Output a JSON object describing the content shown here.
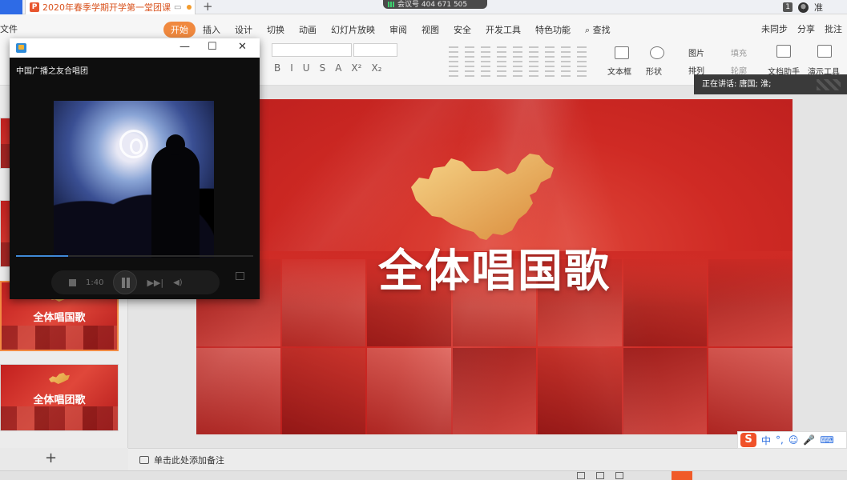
{
  "window": {
    "doc_tab_title": "2020年春季学期开学第一堂团课",
    "new_tab_symbol": "+",
    "meeting_label": "会议号 404 671 505",
    "page_badge": "1",
    "user_name": "准"
  },
  "menu": {
    "file_label": "文件",
    "tabs": [
      "开始",
      "插入",
      "设计",
      "切换",
      "动画",
      "幻灯片放映",
      "审阅",
      "视图",
      "安全",
      "开发工具",
      "特色功能"
    ],
    "active_tab": "开始",
    "search_label": "查找",
    "sync_label": "未同步",
    "share_label": "分享",
    "comment_label": "批注"
  },
  "ribbon": {
    "format_buttons": [
      "B",
      "I",
      "U",
      "S",
      "A",
      "X²",
      "X₂"
    ],
    "textbox_label": "文本框",
    "shape_label": "形状",
    "picture_label": "图片",
    "fill_label": "填充",
    "arrange_label": "排列",
    "outline_label": "轮廓",
    "assistant_label": "文档助手",
    "present_label": "演示工具"
  },
  "thumbnails": [
    {
      "title": "全体唱国歌",
      "selected": true
    },
    {
      "title": "全体唱团歌",
      "selected": false
    }
  ],
  "slide": {
    "title": "全体唱国歌",
    "bg_color": "#cf2a24",
    "map_color": "#f0bd62"
  },
  "speaking_tooltip": "正在讲话: 唐国; 淮;",
  "notes_placeholder": "单击此处添加备注",
  "player": {
    "song_title": "中国广播之友合唱团",
    "time": "1:40",
    "progress": 0.22,
    "minimize": "—",
    "maximize": "☐",
    "close": "✕"
  },
  "ime": {
    "logo": "S",
    "lang": "中",
    "punct": "°,"
  }
}
